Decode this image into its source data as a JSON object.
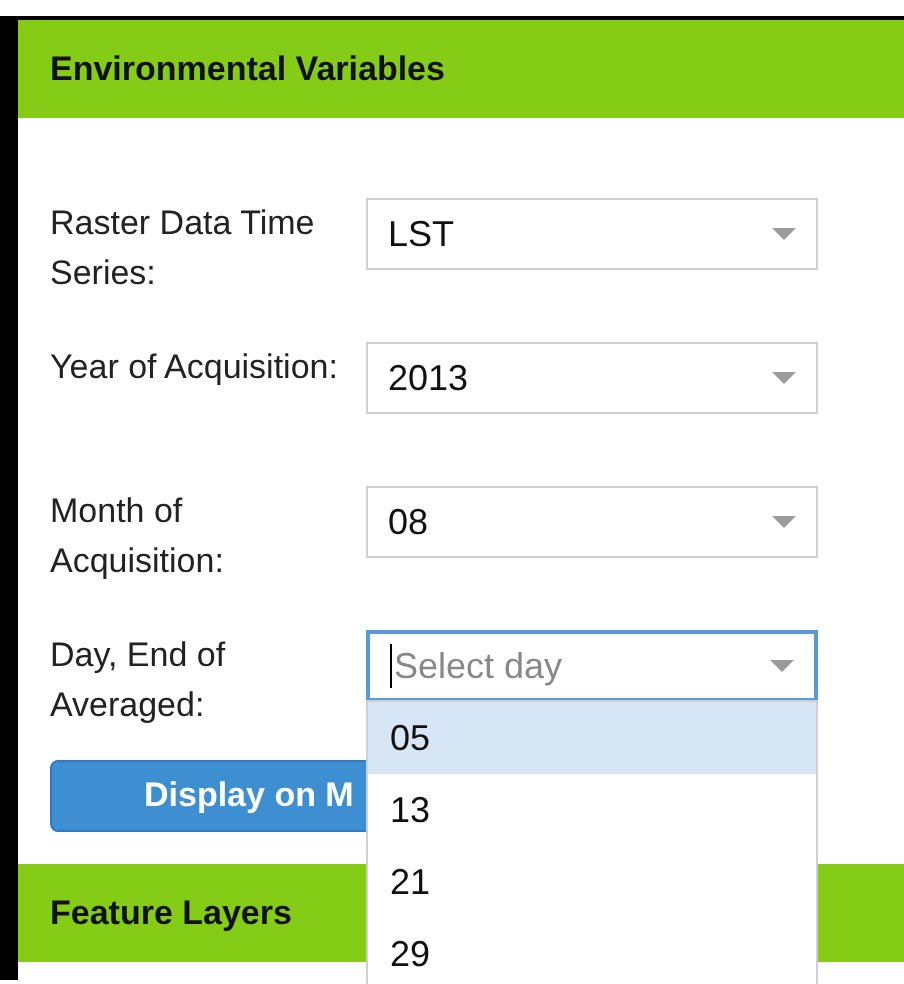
{
  "sections": [
    {
      "title": "Environmental Variables"
    },
    {
      "title": "Feature Layers"
    }
  ],
  "fields": [
    {
      "label": "Raster Data Time Series:",
      "value": "LST",
      "focused": false
    },
    {
      "label": "Year of Acquisition:",
      "value": "2013",
      "focused": false
    },
    {
      "label": "Month of Acquisition:",
      "value": "08",
      "focused": false
    },
    {
      "label": "Day, End of Averaged:",
      "placeholder": "Select day",
      "focused": true,
      "open": true,
      "options": [
        {
          "label": "05",
          "selected": true
        },
        {
          "label": "13",
          "selected": false
        },
        {
          "label": "21",
          "selected": false
        },
        {
          "label": "29",
          "selected": false
        }
      ]
    }
  ],
  "button": {
    "label": "Display on M"
  }
}
